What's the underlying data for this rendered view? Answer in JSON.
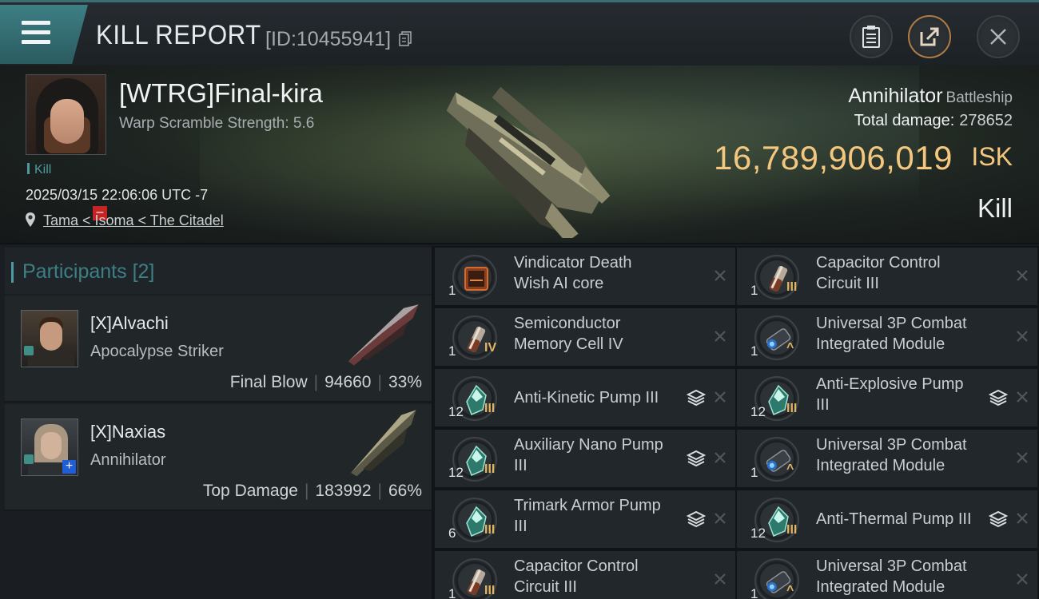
{
  "header": {
    "title": "KILL REPORT",
    "id_label": "[ID:10455941]"
  },
  "victim": {
    "name": "[WTRG]Final-kira",
    "warp_scramble": "Warp Scramble Strength: 5.6",
    "result_tag": "Kill",
    "datetime": "2025/03/15 22:06:06 UTC -7",
    "location": "Tama < Isoma < The Citadel",
    "ship_name": "Annihilator",
    "ship_class": "Battleship",
    "total_damage_label": "Total damage:",
    "total_damage": "278652",
    "isk_value": "16,789,906,019",
    "isk_unit": "ISK",
    "result": "Kill"
  },
  "participants": {
    "title": "Participants",
    "count": "[2]",
    "items": [
      {
        "name": "[X]Alvachi",
        "ship": "Apocalypse Striker",
        "label": "Final Blow",
        "damage": "94660",
        "percent": "33%"
      },
      {
        "name": "[X]Naxias",
        "ship": "Annihilator",
        "label": "Top Damage",
        "damage": "183992",
        "percent": "66%"
      }
    ]
  },
  "modules": [
    {
      "name1": "Vindicator Death",
      "name2": "Wish AI core",
      "qty": "1",
      "tier": "",
      "stack": false,
      "icon": "ai-core-icon"
    },
    {
      "name1": "Capacitor Control",
      "name2": "Circuit III",
      "qty": "1",
      "tier": "III",
      "stack": false,
      "icon": "capacitor-icon"
    },
    {
      "name1": "Semiconductor",
      "name2": "Memory Cell IV",
      "qty": "1",
      "tier": "IV",
      "stack": false,
      "icon": "memory-cell-icon"
    },
    {
      "name1": "Universal 3P Combat",
      "name2": "Integrated Module",
      "qty": "1",
      "tier": "^",
      "stack": false,
      "icon": "combat-module-icon"
    },
    {
      "name1": "Anti-Kinetic Pump III",
      "name2": "",
      "qty": "12",
      "tier": "III",
      "stack": true,
      "icon": "pump-icon"
    },
    {
      "name1": "Anti-Explosive Pump",
      "name2": "III",
      "qty": "12",
      "tier": "III",
      "stack": true,
      "icon": "pump-icon"
    },
    {
      "name1": "Auxiliary Nano Pump",
      "name2": "III",
      "qty": "12",
      "tier": "III",
      "stack": true,
      "icon": "pump-icon"
    },
    {
      "name1": "Universal 3P Combat",
      "name2": "Integrated Module",
      "qty": "1",
      "tier": "^",
      "stack": false,
      "icon": "combat-module-icon"
    },
    {
      "name1": "Trimark Armor Pump",
      "name2": "III",
      "qty": "6",
      "tier": "III",
      "stack": true,
      "icon": "pump-icon"
    },
    {
      "name1": "Anti-Thermal Pump III",
      "name2": "",
      "qty": "12",
      "tier": "III",
      "stack": true,
      "icon": "pump-icon"
    },
    {
      "name1": "Capacitor Control",
      "name2": "Circuit III",
      "qty": "1",
      "tier": "III",
      "stack": false,
      "icon": "capacitor-icon"
    },
    {
      "name1": "Universal 3P Combat",
      "name2": "Integrated Module",
      "qty": "1",
      "tier": "^",
      "stack": false,
      "icon": "combat-module-icon"
    }
  ],
  "colors": {
    "accent": "#4f9aa0",
    "isk": "#f4c77e",
    "tier": "#e1b562",
    "panel": "#22272b"
  }
}
